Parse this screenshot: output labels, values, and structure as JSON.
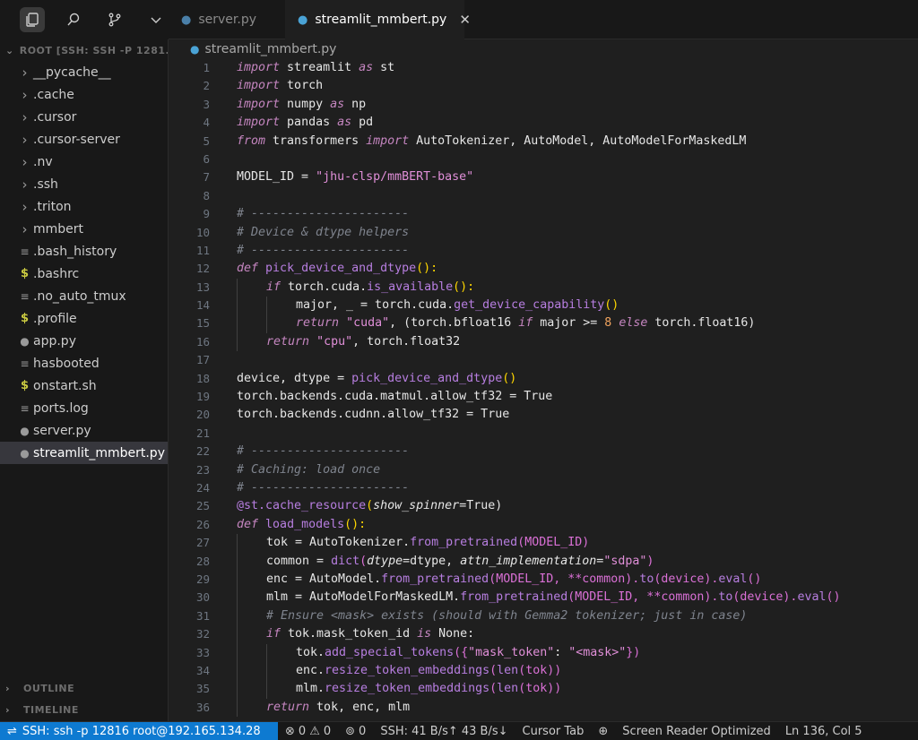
{
  "tabs": [
    {
      "label": "server.py",
      "active": false
    },
    {
      "label": "streamlit_mmbert.py",
      "active": true
    }
  ],
  "tab_close": "✕",
  "explorer": {
    "root_label": "ROOT [SSH: SSH -P 1281...",
    "items": [
      {
        "label": "__pycache__",
        "type": "folder"
      },
      {
        "label": ".cache",
        "type": "folder"
      },
      {
        "label": ".cursor",
        "type": "folder"
      },
      {
        "label": ".cursor-server",
        "type": "folder"
      },
      {
        "label": ".nv",
        "type": "folder"
      },
      {
        "label": ".ssh",
        "type": "folder"
      },
      {
        "label": ".triton",
        "type": "folder"
      },
      {
        "label": "mmbert",
        "type": "folder"
      },
      {
        "label": ".bash_history",
        "type": "file"
      },
      {
        "label": ".bashrc",
        "type": "shell"
      },
      {
        "label": ".no_auto_tmux",
        "type": "file"
      },
      {
        "label": ".profile",
        "type": "shell"
      },
      {
        "label": "app.py",
        "type": "python"
      },
      {
        "label": "hasbooted",
        "type": "file"
      },
      {
        "label": "onstart.sh",
        "type": "shell"
      },
      {
        "label": "ports.log",
        "type": "file"
      },
      {
        "label": "server.py",
        "type": "python"
      },
      {
        "label": "streamlit_mmbert.py",
        "type": "python",
        "selected": true
      }
    ],
    "outline_label": "OUTLINE",
    "timeline_label": "TIMELINE"
  },
  "breadcrumb": "streamlit_mmbert.py",
  "code_lines": [
    "1",
    "2",
    "3",
    "4",
    "5",
    "6",
    "7",
    "8",
    "9",
    "10",
    "11",
    "12",
    "13",
    "14",
    "15",
    "16",
    "17",
    "18",
    "19",
    "20",
    "21",
    "22",
    "23",
    "24",
    "25",
    "26",
    "27",
    "28",
    "29",
    "30",
    "31",
    "32",
    "33",
    "34",
    "35",
    "36"
  ],
  "code": {
    "l1": [
      "import",
      " streamlit ",
      "as",
      " st"
    ],
    "l2": [
      "import",
      " torch"
    ],
    "l3": [
      "import",
      " numpy ",
      "as",
      " np"
    ],
    "l4": [
      "import",
      " pandas ",
      "as",
      " pd"
    ],
    "l5": [
      "from",
      " transformers ",
      "import",
      " AutoTokenizer, AutoModel, AutoModelForMaskedLM"
    ],
    "l7": [
      "MODEL_ID = ",
      "\"jhu-clsp/mmBERT-base\""
    ],
    "l9": "# ----------------------",
    "l10": "# Device & dtype helpers",
    "l11": "# ----------------------",
    "l12": [
      "def",
      " ",
      "pick_device_and_dtype",
      "():",
      ""
    ],
    "l13": [
      "if",
      " torch.cuda.",
      "is_available",
      "():"
    ],
    "l14": [
      "major, _ = torch.cuda.",
      "get_device_capability",
      "()"
    ],
    "l15": [
      "return",
      " ",
      "\"cuda\"",
      ", (torch.bfloat16 ",
      "if",
      " major >= ",
      "8",
      " ",
      "else",
      " torch.float16)"
    ],
    "l16": [
      "return",
      " ",
      "\"cpu\"",
      ", torch.float32"
    ],
    "l18": [
      "device, dtype = ",
      "pick_device_and_dtype",
      "()"
    ],
    "l19": "torch.backends.cuda.matmul.allow_tf32 = True",
    "l20": "torch.backends.cudnn.allow_tf32 = True",
    "l22": "# ----------------------",
    "l23": "# Caching: load once",
    "l24": "# ----------------------",
    "l25": [
      "@st.",
      "cache_resource",
      "(",
      "show_spinner",
      "=True)"
    ],
    "l26": [
      "def",
      " ",
      "load_models",
      "():"
    ],
    "l27": [
      "tok = AutoTokenizer.",
      "from_pretrained",
      "(MODEL_ID)"
    ],
    "l28": [
      "common = ",
      "dict",
      "(",
      "dtype",
      "=dtype, ",
      "attn_implementation",
      "=",
      "\"sdpa\"",
      ")"
    ],
    "l29": [
      "enc = AutoModel.",
      "from_pretrained",
      "(MODEL_ID, **common).",
      "to",
      "(device).",
      "eval",
      "()"
    ],
    "l30": [
      "mlm = AutoModelForMaskedLM.",
      "from_pretrained",
      "(MODEL_ID, **common).",
      "to",
      "(device).",
      "eval",
      "()"
    ],
    "l31": "# Ensure <mask> exists (should with Gemma2 tokenizer; just in case)",
    "l32": [
      "if",
      " tok.mask_token_id ",
      "is",
      " None:"
    ],
    "l33": [
      "tok.",
      "add_special_tokens",
      "({",
      "\"mask_token\"",
      ": ",
      "\"<mask>\"",
      "})"
    ],
    "l34": [
      "enc.",
      "resize_token_embeddings",
      "(",
      "len",
      "(tok))"
    ],
    "l35": [
      "mlm.",
      "resize_token_embeddings",
      "(",
      "len",
      "(tok))"
    ],
    "l36": [
      "return",
      " tok, enc, mlm"
    ]
  },
  "status": {
    "remote": "SSH: ssh -p 12816 root@192.165.134.28",
    "errors": "0",
    "warnings": "0",
    "ports": "0",
    "ssh_speed": "SSH: 41 B/s↑ 43 B/s↓",
    "cursor_tab": "Cursor Tab",
    "screen_reader": "Screen Reader Optimized",
    "position": "Ln 136, Col 5"
  }
}
